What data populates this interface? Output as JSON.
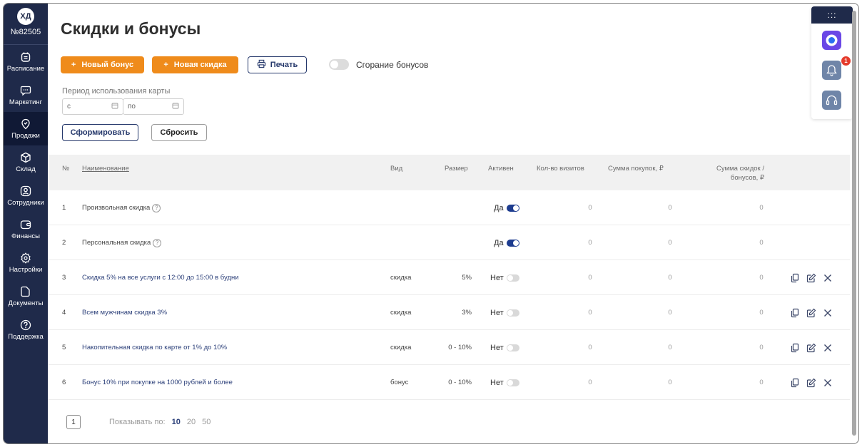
{
  "user": {
    "initials": "ХД",
    "number": "№82505"
  },
  "sidebar": {
    "items": [
      {
        "label": "Расписание",
        "icon": "calendar-icon"
      },
      {
        "label": "Маркетинг",
        "icon": "chat-icon"
      },
      {
        "label": "Продажи",
        "icon": "tag-icon",
        "active": true
      },
      {
        "label": "Склад",
        "icon": "box-icon"
      },
      {
        "label": "Сотрудники",
        "icon": "person-icon"
      },
      {
        "label": "Финансы",
        "icon": "wallet-icon"
      },
      {
        "label": "Настройки",
        "icon": "gear-icon"
      },
      {
        "label": "Документы",
        "icon": "folder-icon"
      },
      {
        "label": "Поддержка",
        "icon": "help-icon"
      }
    ]
  },
  "page": {
    "title": "Скидки и бонусы",
    "new_bonus": "Новый бонус",
    "new_discount": "Новая скидка",
    "print": "Печать",
    "bonus_expiry": "Сгорание бонусов",
    "period_label": "Период использования карты",
    "date_from_placeholder": "с",
    "date_to_placeholder": "по",
    "generate": "Сформировать",
    "reset": "Сбросить"
  },
  "table": {
    "headers": {
      "num": "№",
      "name": "Наименование",
      "type": "Вид",
      "size": "Размер",
      "active": "Активен",
      "visits": "Кол-во визитов",
      "purchases": "Сумма покупок, ₽",
      "discounts_line1": "Сумма скидок /",
      "discounts_line2": "бонусов, ₽"
    },
    "rows": [
      {
        "num": "1",
        "name": "Произвольная скидка",
        "help": "?",
        "type": "",
        "size": "",
        "active": "Да",
        "visits": "0",
        "purchases": "0",
        "discounts": "0"
      },
      {
        "num": "2",
        "name": "Персональная скидка",
        "help": "?",
        "type": "",
        "size": "",
        "active": "Да",
        "visits": "0",
        "purchases": "0",
        "discounts": "0"
      },
      {
        "num": "3",
        "name": "Скидка 5% на все услуги с 12:00 до 15:00 в будни",
        "type": "скидка",
        "size": "5%",
        "active": "Нет",
        "visits": "0",
        "purchases": "0",
        "discounts": "0"
      },
      {
        "num": "4",
        "name": "Всем мужчинам скидка 3%",
        "type": "скидка",
        "size": "3%",
        "active": "Нет",
        "visits": "0",
        "purchases": "0",
        "discounts": "0"
      },
      {
        "num": "5",
        "name": "Накопительная скидка по карте от 1% до 10%",
        "type": "скидка",
        "size": "0 - 10%",
        "active": "Нет",
        "visits": "0",
        "purchases": "0",
        "discounts": "0"
      },
      {
        "num": "6",
        "name": "Бонус 10% при покупке на 1000 рублей и более",
        "type": "бонус",
        "size": "0 - 10%",
        "active": "Нет",
        "visits": "0",
        "purchases": "0",
        "discounts": "0"
      }
    ]
  },
  "pagination": {
    "current_page": "1",
    "show_by_label": "Показывать по:",
    "options": [
      "10",
      "20",
      "50"
    ],
    "selected": "10"
  },
  "widgets": {
    "menu_dots": ":::",
    "notifications_count": "1"
  },
  "colors": {
    "sidebar": "#1f2a4a",
    "accent": "#ef8b1b",
    "link": "#2b3f79",
    "toggle_on": "#1d3c8f"
  }
}
